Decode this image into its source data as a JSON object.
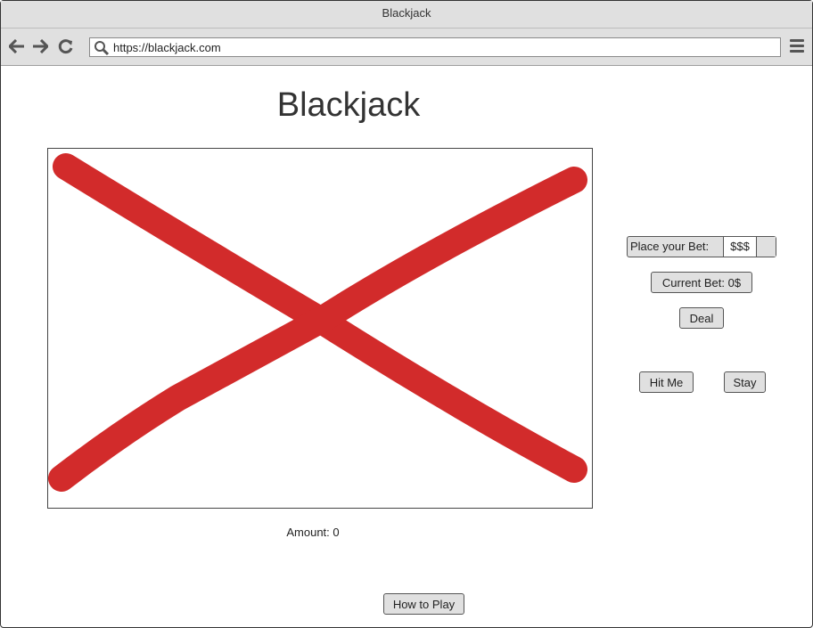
{
  "window": {
    "title": "Blackjack"
  },
  "browser": {
    "url": "https://blackjack.com",
    "icons": [
      "back-arrow-icon",
      "forward-arrow-icon",
      "reload-icon",
      "search-icon",
      "hamburger-menu-icon"
    ]
  },
  "page": {
    "title": "Blackjack",
    "amount_label": "Amount: 0",
    "how_to_play_label": "How to Play"
  },
  "controls": {
    "bet_label": "Place your Bet:",
    "bet_value": "$$$",
    "current_bet_label": "Current Bet: 0$",
    "deal_label": "Deal",
    "hit_label": "Hit Me",
    "stay_label": "Stay"
  },
  "colors": {
    "placeholder_cross": "#d22b2b",
    "chrome": "#e0e0e0"
  }
}
